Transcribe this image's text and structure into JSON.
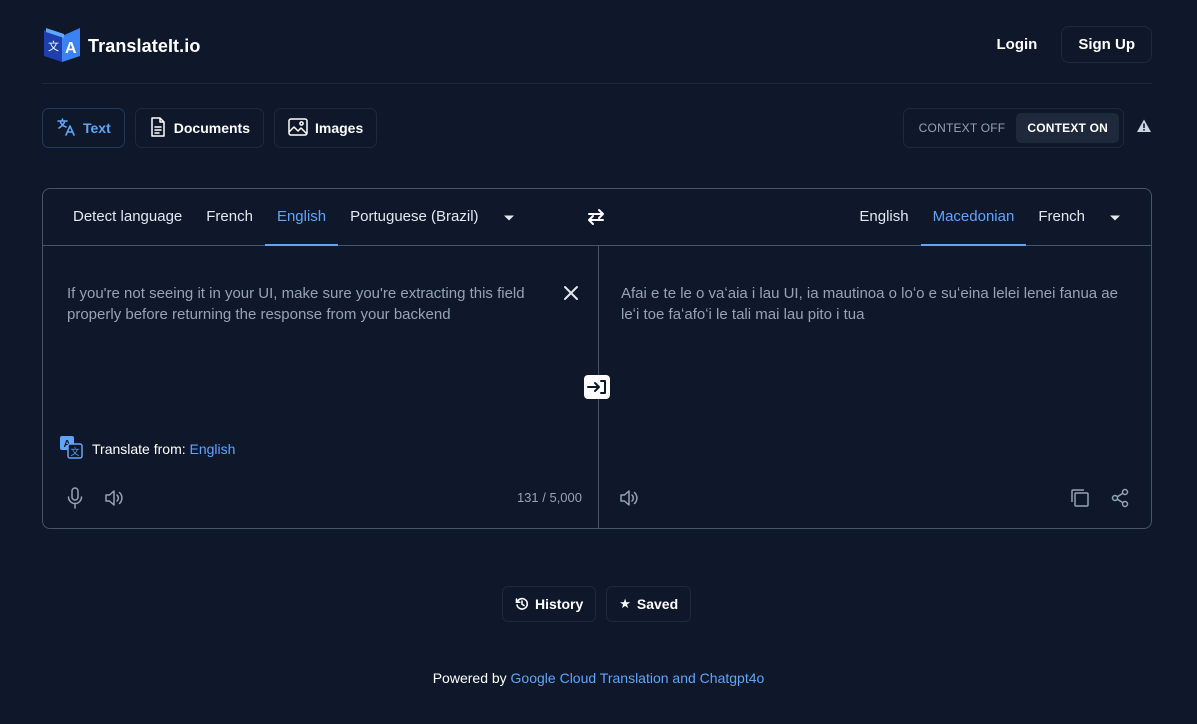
{
  "brand": {
    "name": "TranslateIt.io"
  },
  "auth": {
    "login": "Login",
    "signup": "Sign Up"
  },
  "modes": [
    {
      "label": "Text",
      "icon": "translate-icon",
      "active": true
    },
    {
      "label": "Documents",
      "icon": "document-icon",
      "active": false
    },
    {
      "label": "Images",
      "icon": "image-icon",
      "active": false
    }
  ],
  "context": {
    "off_label": "CONTEXT OFF",
    "on_label": "CONTEXT ON",
    "selected": "on",
    "info_icon": "warning-icon"
  },
  "source_languages": [
    "Detect language",
    "French",
    "English",
    "Portuguese (Brazil)"
  ],
  "source_selected": "English",
  "target_languages": [
    "English",
    "Macedonian",
    "French"
  ],
  "target_selected": "Macedonian",
  "source": {
    "text": "If you're not seeing it in your UI, make sure you're extracting this field properly before returning the response from your backend",
    "detect_prefix": "Translate from:",
    "detect_language": "English",
    "char_count": "131 / 5,000"
  },
  "target": {
    "text": "Afai e te le o vaʻaia i lau UI, ia mautinoa o loʻo e suʻeina lelei lenei fanua ae leʻi toe faʻafoʻi le tali mai lau pito i tua"
  },
  "actions": {
    "history": "History",
    "saved": "Saved"
  },
  "footer": {
    "prefix": "Powered by",
    "link": "Google Cloud Translation and Chatgpt4o"
  },
  "colors": {
    "background": "#0f172a",
    "accent": "#60a5fa",
    "border": "#475569"
  }
}
